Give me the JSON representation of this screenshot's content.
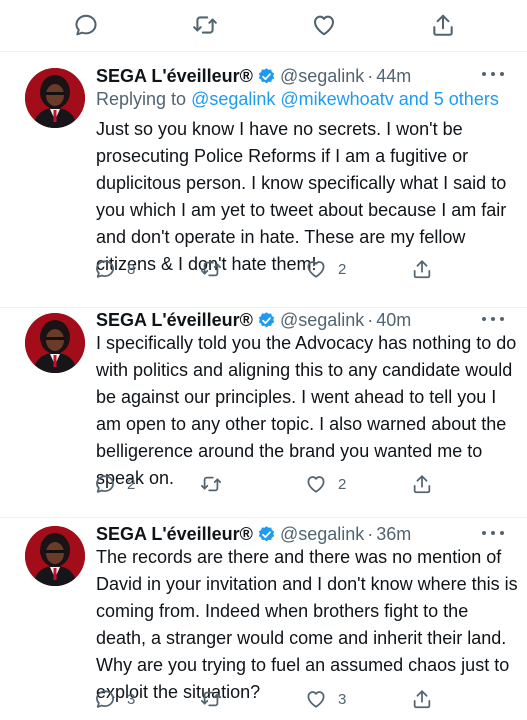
{
  "colors": {
    "accent": "#1d9bf0",
    "muted": "#536471",
    "text": "#0f1419"
  },
  "top_actions": {
    "icons": [
      "reply-icon",
      "retweet-icon",
      "like-icon",
      "share-icon"
    ]
  },
  "tweets": [
    {
      "name": "SEGA L'éveilleur®",
      "handle": "@segalink",
      "dot": "·",
      "time": "44m",
      "reply_prefix": "Replying to",
      "reply_mentions": "@segalink @mikewhoatv",
      "reply_and": "and",
      "reply_others": "5 others",
      "lines": [
        "Just so you know I have no secrets. I won't be",
        "prosecuting Police Reforms if I am a fugitive or",
        "duplicitous person. I know specifically what I said to",
        "you which I am yet to tweet about because I am fair",
        "and don't operate in hate. These are my fellow",
        "citizens & I don't hate them!"
      ],
      "reply_count": "8",
      "retweet_count": "",
      "like_count": "2"
    },
    {
      "name": "SEGA L'éveilleur®",
      "handle": "@segalink",
      "dot": "·",
      "time": "40m",
      "lines": [
        "I specifically told you the Advocacy has nothing to do",
        "with politics and aligning this to any candidate would",
        "be against our principles. I went ahead to tell you I",
        "am open to any other topic. I also warned about the",
        "belligerence around the brand you wanted me to",
        "speak on."
      ],
      "reply_count": "2",
      "retweet_count": "",
      "like_count": "2"
    },
    {
      "name": "SEGA L'éveilleur®",
      "handle": "@segalink",
      "dot": "·",
      "time": "36m",
      "lines": [
        "The records are there and there was no mention of",
        "David in your invitation and I don't know where this is",
        "coming from. Indeed when brothers fight to the",
        "death, a stranger would come and inherit their land.",
        "Why are you trying to fuel an assumed chaos just to",
        "exploit the situation?"
      ],
      "reply_count": "3",
      "retweet_count": "",
      "like_count": "3"
    }
  ]
}
